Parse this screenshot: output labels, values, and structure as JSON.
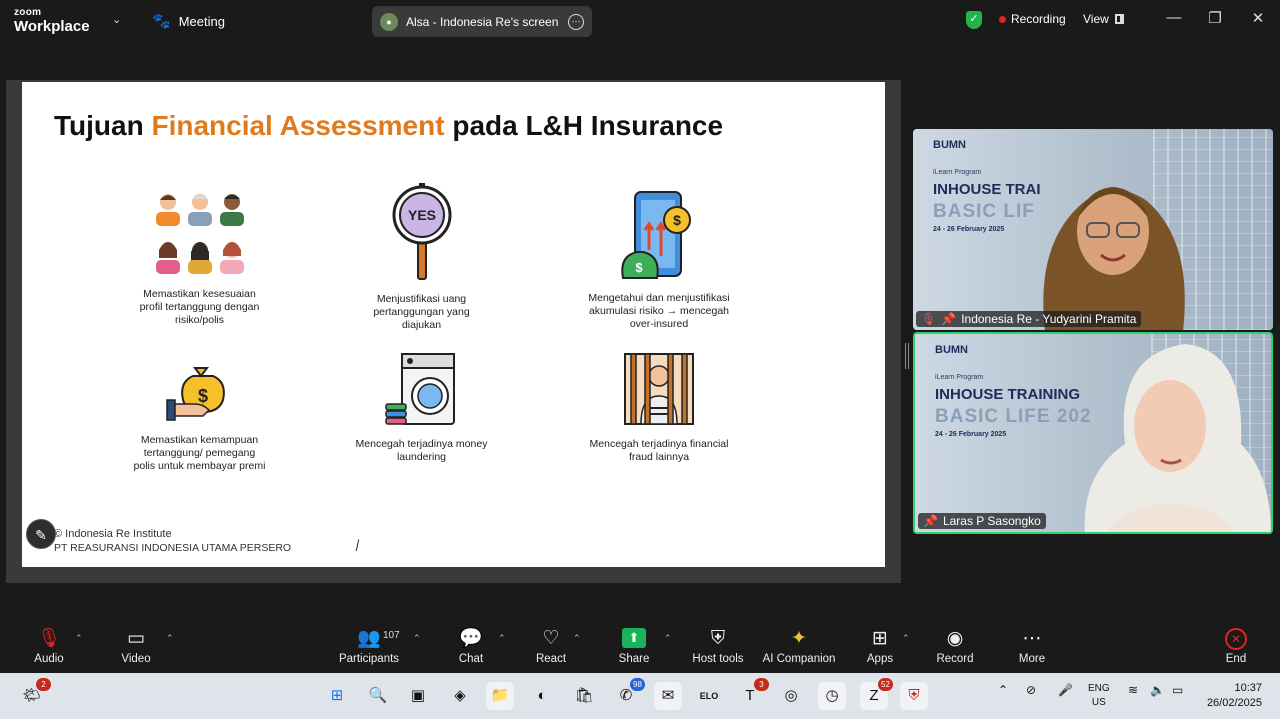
{
  "app": {
    "brand_top": "zoom",
    "brand_main": "Workplace"
  },
  "topbar": {
    "meeting_label": "Meeting",
    "share_label": "Alsa - Indonesia Re's screen",
    "recording_label": "Recording",
    "view_label": "View"
  },
  "slide": {
    "title_pre": "Tujuan ",
    "title_accent": "Financial Assessment",
    "title_post": " pada L&H Insurance",
    "items": [
      {
        "text": "Memastikan kesesuaian profil tertanggung dengan risiko/polis",
        "icon": "people-icon"
      },
      {
        "text": "Menjustifikasi uang pertanggungan yang diajukan",
        "icon": "yes-sign-icon"
      },
      {
        "text": "Mengetahui dan menjustifikasi akumulasi risiko → mencegah over-insured",
        "icon": "money-growth-icon"
      },
      {
        "text": "Memastikan kemampuan tertanggung/ pemegang polis untuk membayar premi",
        "icon": "hand-money-bag-icon"
      },
      {
        "text": "Mencegah terjadinya money laundering",
        "icon": "washing-machine-icon"
      },
      {
        "text": "Mencegah terjadinya financial fraud lainnya",
        "icon": "prisoner-icon"
      }
    ],
    "footer_line1": "© Indonesia Re Institute",
    "footer_line2": "PT REASURANSI INDONESIA UTAMA PERSERO"
  },
  "tiles": [
    {
      "name": "Indonesia Re - Yudyarini Pramita",
      "bumn": "BUMN",
      "program": "iLearn Program",
      "title1": "INHOUSE TRAI",
      "title2": "BASIC LIF",
      "date": "24 - 26 February 2025"
    },
    {
      "name": "Laras P Sasongko",
      "bumn": "BUMN",
      "program": "iLearn Program",
      "title1": "INHOUSE TRAINING",
      "title2": "BASIC LIFE 202",
      "date": "24 - 26 February 2025"
    }
  ],
  "toolbar": {
    "audio": "Audio",
    "video": "Video",
    "participants": "Participants",
    "participants_count": "107",
    "chat": "Chat",
    "react": "React",
    "share": "Share",
    "host_tools": "Host tools",
    "ai_companion": "AI Companion",
    "apps": "Apps",
    "record": "Record",
    "more": "More",
    "end": "End"
  },
  "taskbar": {
    "weather_badge": "2",
    "whatsapp_badge": "98",
    "teams_badge": "3",
    "zoom_badge": "52",
    "elo_label": "ELO",
    "lang_top": "ENG",
    "lang_bottom": "US",
    "time": "10:37",
    "date": "26/02/2025"
  },
  "colors": {
    "accent": "#e07a1c",
    "recording": "#e02424",
    "active_speaker": "#2dd36f",
    "share_green": "#19b35b"
  }
}
